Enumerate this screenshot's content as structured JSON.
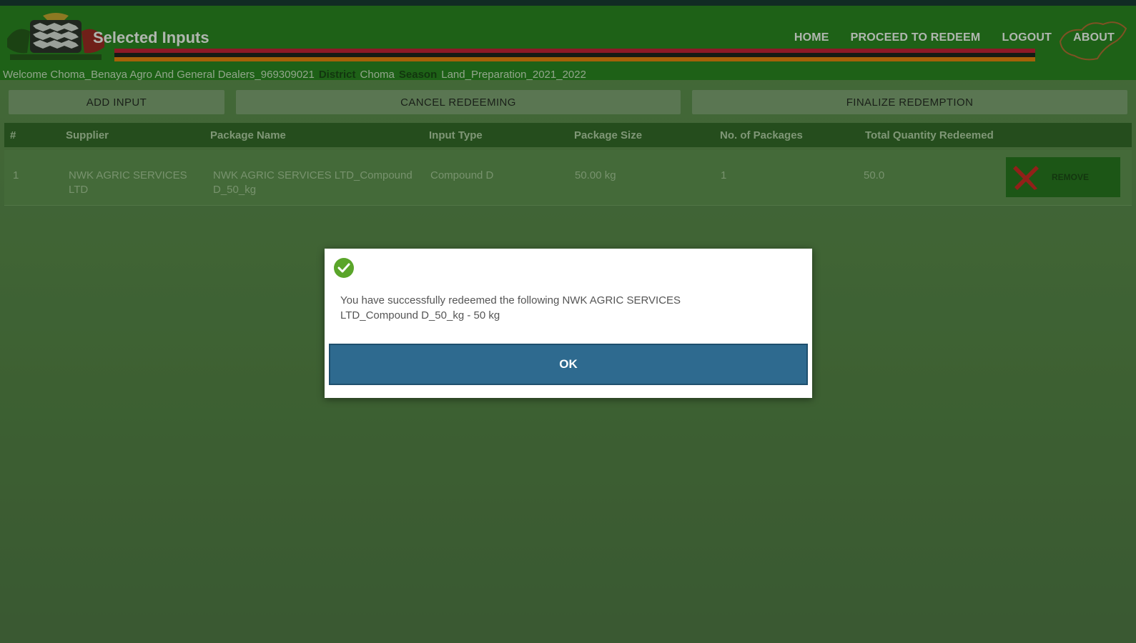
{
  "header": {
    "title": "Selected Inputs",
    "nav": [
      "HOME",
      "PROCEED TO REDEEM",
      "LOGOUT",
      "ABOUT"
    ],
    "flag_colors": [
      "#1f7d16",
      "#c8102e",
      "#000000",
      "#ef7d00"
    ]
  },
  "welcome": {
    "text": "Welcome Choma_Benaya Agro And General Dealers_969309021",
    "district_label": "District",
    "district": "Choma",
    "season_label": "Season",
    "season": "Land_Preparation_2021_2022"
  },
  "actions": {
    "add": "ADD INPUT",
    "cancel": "CANCEL REDEEMING",
    "finalize": "FINALIZE REDEMPTION"
  },
  "table": {
    "headers": [
      "#",
      "Supplier",
      "Package Name",
      "Input Type",
      "Package Size",
      "No. of Packages",
      "Total Quantity Redeemed"
    ],
    "rows": [
      {
        "num": "1",
        "supplier": "NWK AGRIC SERVICES LTD",
        "package_name": "NWK AGRIC SERVICES LTD_Compound D_50_kg",
        "input_type": "Compound D",
        "package_size": "50.00 kg",
        "packages": "1",
        "total": "50.0",
        "remove_label": "REMOVE"
      }
    ]
  },
  "dialog": {
    "icon": "check-circle-icon",
    "message": "You have successfully redeemed the following NWK AGRIC SERVICES LTD_Compound D_50_kg - 50 kg",
    "ok": "OK"
  }
}
